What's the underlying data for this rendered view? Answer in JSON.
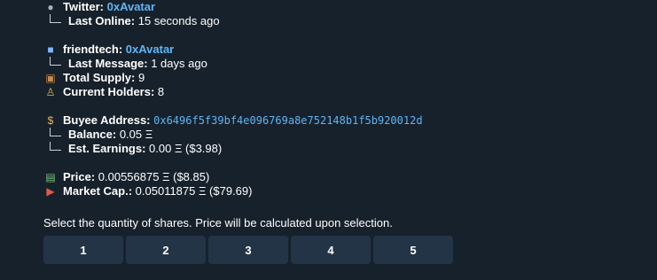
{
  "message": {
    "twitter": {
      "label": "Twitter:",
      "value": "0xAvatar",
      "last_online_label": "Last Online:",
      "last_online_value": "15 seconds ago"
    },
    "friendtech": {
      "label": "friendtech:",
      "value": "0xAvatar",
      "last_message_label": "Last Message:",
      "last_message_value": "1 days ago",
      "total_supply_label": "Total Supply:",
      "total_supply_value": "9",
      "current_holders_label": "Current Holders:",
      "current_holders_value": "8"
    },
    "buyee": {
      "address_label": "Buyee Address:",
      "address_value": "0x6496f5f39bf4e096769a8e752148b1f5b920012d",
      "balance_label": "Balance:",
      "balance_value": "0.05 Ξ",
      "earnings_label": "Est. Earnings:",
      "earnings_value": "0.00 Ξ ($3.98)"
    },
    "price": {
      "label": "Price:",
      "value": "0.00556875 Ξ ($8.85)"
    },
    "market_cap": {
      "label": "Market Cap.:",
      "value": "0.05011875 Ξ ($79.69)"
    }
  },
  "prompt": "Select the quantity of shares. Price will be calculated upon selection.",
  "keyboard": [
    "1",
    "2",
    "3",
    "4",
    "5"
  ],
  "icons": {
    "twitter": "bird-icon",
    "friendtech": "app-icon",
    "supply": "package-icon",
    "holders": "people-icon",
    "buyee": "money-bag-icon",
    "price": "dollar-bills-icon",
    "market_cap": "truck-icon"
  }
}
